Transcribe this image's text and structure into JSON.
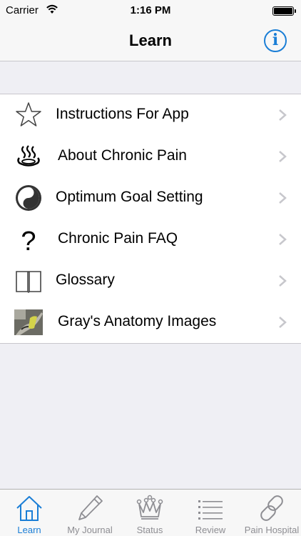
{
  "status_bar": {
    "carrier": "Carrier",
    "time": "1:16 PM",
    "wifi_icon": "wifi-icon",
    "battery_icon": "battery-icon"
  },
  "nav": {
    "title": "Learn",
    "info_label": "i",
    "info_icon": "info-icon"
  },
  "menu": {
    "items": [
      {
        "label": "Instructions For App",
        "icon": "star-icon"
      },
      {
        "label": "About Chronic Pain",
        "icon": "hot-spring-icon"
      },
      {
        "label": "Optimum Goal Setting",
        "icon": "yin-yang-icon"
      },
      {
        "label": "Chronic Pain FAQ",
        "icon": "question-mark-icon"
      },
      {
        "label": "Glossary",
        "icon": "open-book-icon"
      },
      {
        "label": "Gray's Anatomy Images",
        "icon": "anatomy-thumbnail"
      }
    ]
  },
  "tabs": [
    {
      "label": "Learn",
      "icon": "home-icon",
      "active": true
    },
    {
      "label": "My Journal",
      "icon": "pencil-icon",
      "active": false
    },
    {
      "label": "Status",
      "icon": "crown-icon",
      "active": false
    },
    {
      "label": "Review",
      "icon": "list-icon",
      "active": false
    },
    {
      "label": "Pain Hospital",
      "icon": "link-icon",
      "active": false
    }
  ],
  "colors": {
    "accent": "#1a7ed6",
    "inactive_tab": "#8e8e93",
    "background": "#efeff4",
    "separator": "#c8c7cc"
  }
}
